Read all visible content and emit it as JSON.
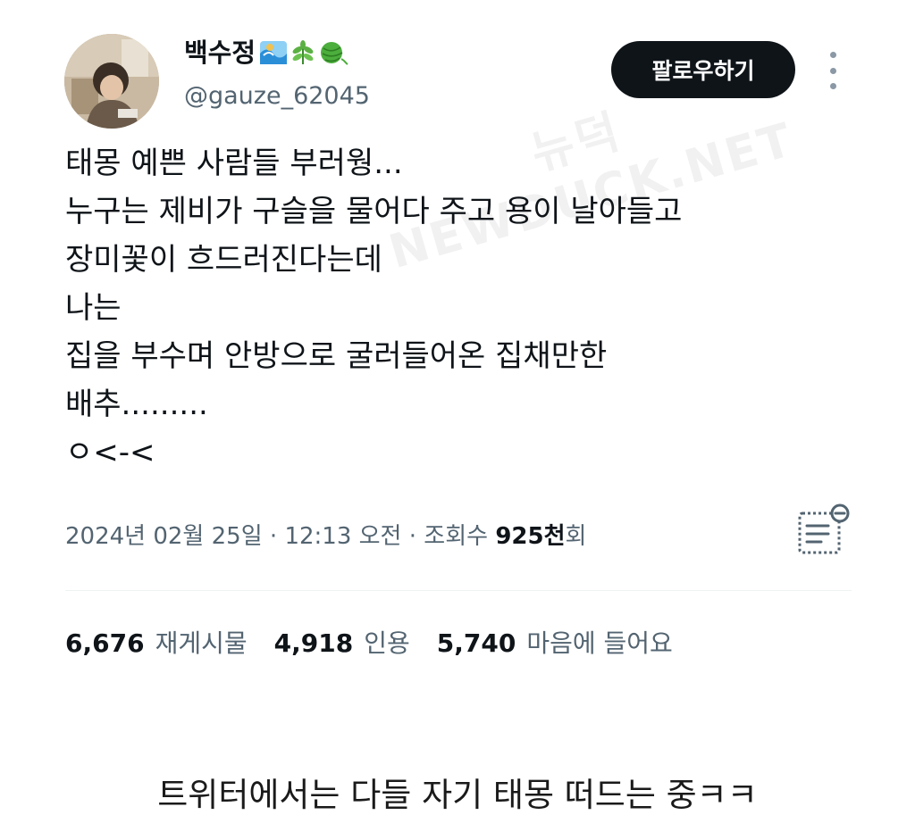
{
  "profile": {
    "display_name": "백수정",
    "handle": "@gauze_62045",
    "emojis": [
      "wave-emoji",
      "herb-emoji",
      "yarn-emoji"
    ]
  },
  "header": {
    "follow_label": "팔로우하기"
  },
  "watermark": {
    "line1": "뉴덕",
    "line2": "NEWDUCK.NET"
  },
  "tweet": {
    "lines": [
      "태몽 예쁜 사람들 부러웡...",
      "누구는 제비가 구슬을 물어다 주고 용이 날아들고",
      "장미꽃이 흐드러진다는데",
      "나는",
      "집을 부수며 안방으로 굴러들어온 집채만한",
      "배추.........",
      "ㅇ<-<"
    ]
  },
  "meta": {
    "date": "2024년 02월 25일",
    "separator1": " · ",
    "time": "12:13 오전",
    "separator2": " · ",
    "views_label": "조회수 ",
    "views_count": "925천",
    "views_suffix": "회"
  },
  "stats": {
    "retweets_count": "6,676",
    "retweets_label": "재게시물",
    "quotes_count": "4,918",
    "quotes_label": "인용",
    "likes_count": "5,740",
    "likes_label": "마음에 들어요"
  },
  "caption": "트위터에서는 다들 자기 태몽 떠드는 중ㅋㅋ",
  "colors": {
    "text_primary": "#0f1419",
    "text_secondary": "#536471",
    "button_bg": "#0f1419",
    "divider": "#eff3f4"
  }
}
